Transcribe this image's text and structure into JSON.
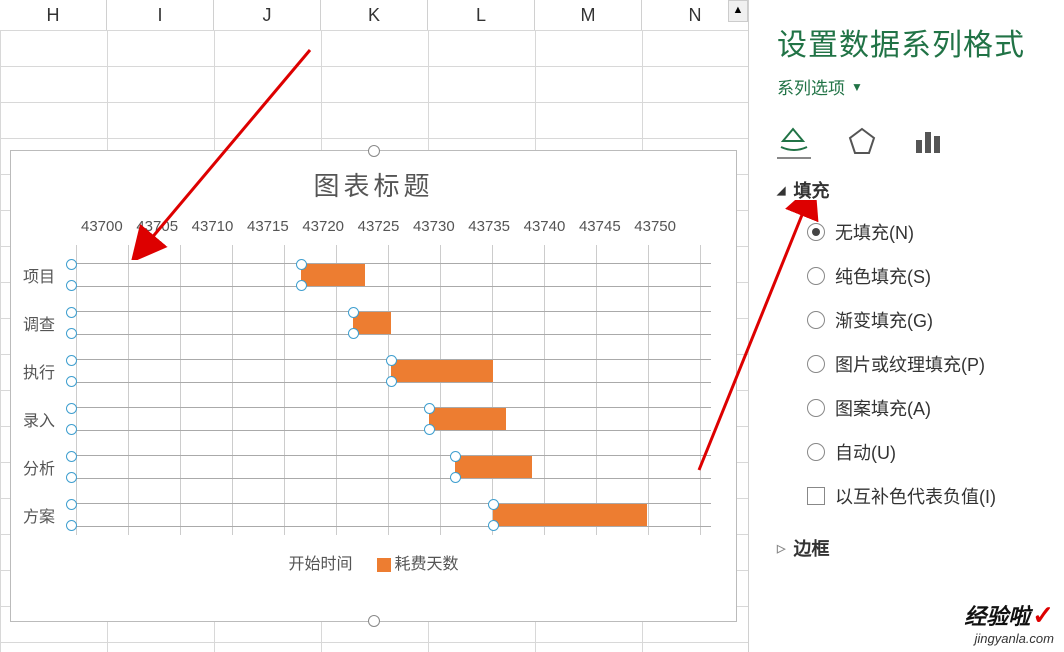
{
  "columns": [
    "H",
    "I",
    "J",
    "K",
    "L",
    "M",
    "N"
  ],
  "panel": {
    "title": "设置数据系列格式",
    "series_options": "系列选项",
    "fill_header": "填充",
    "options": {
      "no_fill": "无填充(N)",
      "solid": "纯色填充(S)",
      "gradient": "渐变填充(G)",
      "picture": "图片或纹理填充(P)",
      "pattern": "图案填充(A)",
      "auto": "自动(U)",
      "invert": "以互补色代表负值(I)"
    },
    "border_header": "边框"
  },
  "watermark": {
    "title": "经验啦",
    "url": "jingyanla.com"
  },
  "chart_data": {
    "type": "bar",
    "title": "图表标题",
    "x_ticks": [
      43700,
      43705,
      43710,
      43715,
      43720,
      43725,
      43730,
      43735,
      43740,
      43745,
      43750
    ],
    "x_min": 43700,
    "x_max": 43750,
    "categories": [
      "项目",
      "调查",
      "执行",
      "录入",
      "分析",
      "方案"
    ],
    "series": [
      {
        "name": "开始时间",
        "values": [
          43700,
          43700,
          43700,
          43700,
          43700,
          43700
        ]
      },
      {
        "name": "耗费天数",
        "start": [
          43718,
          43722,
          43725,
          43728,
          43730,
          43733
        ],
        "duration": [
          5,
          3,
          8,
          6,
          6,
          12
        ]
      }
    ],
    "legend": [
      "开始时间",
      "耗费天数"
    ]
  }
}
